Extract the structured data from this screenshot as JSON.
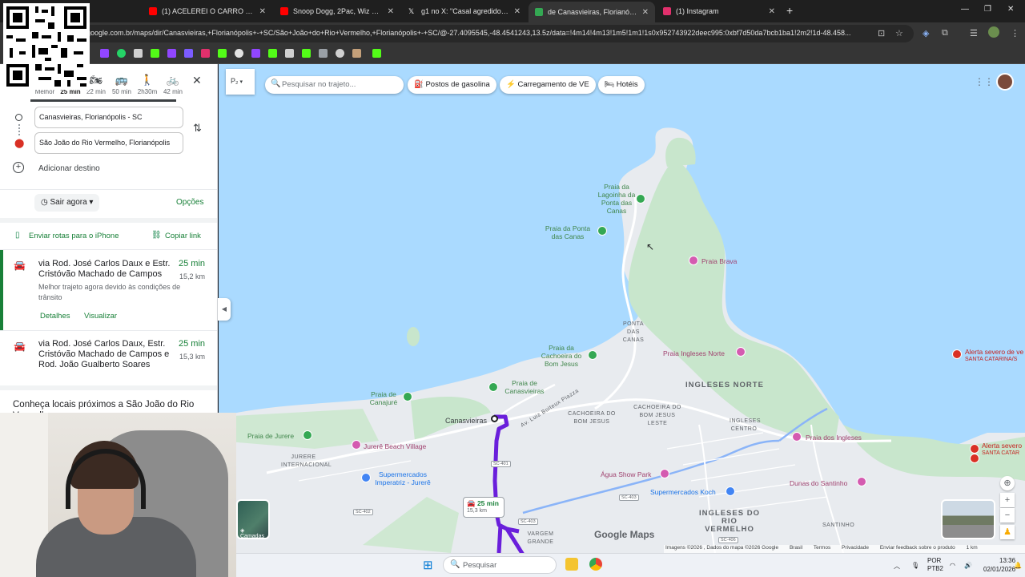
{
  "browser": {
    "tabs": [
      {
        "title": "(1) ACELEREI O CARRO MAIS IN",
        "favicon_color": "#ff0000"
      },
      {
        "title": "Snoop Dogg, 2Pac, Wiz Khalifa",
        "favicon_color": "#ff0000"
      },
      {
        "title": "g1 no X: \"Casal agredido em Po",
        "favicon_color": "#ffffff"
      },
      {
        "title": "de Canasvieiras, Florianópolis -",
        "favicon_color": "#34a853"
      },
      {
        "title": "(1) Instagram",
        "favicon_color": "#e1306c"
      }
    ],
    "url": "google.com.br/maps/dir/Canasvieiras,+Florianópolis+-+SC/São+João+do+Rio+Vermelho,+Florianópolis+-+SC/@-27.4095545,-48.4541243,13.5z/data=!4m14!4m13!1m5!1m1!1s0x952743922deec995:0xbf7d50da7bcb1ba1!2m2!1d-48.458..."
  },
  "directions": {
    "modes": [
      {
        "label": "Melhor",
        "icon": "route-icon"
      },
      {
        "label": "25 min",
        "icon": "car-icon"
      },
      {
        "label": "22 min",
        "icon": "motorcycle-icon"
      },
      {
        "label": "50 min",
        "icon": "bus-icon"
      },
      {
        "label": "2h30m",
        "icon": "walk-icon"
      },
      {
        "label": "42 min",
        "icon": "bike-icon"
      }
    ],
    "origin": "Canasvieiras, Florianópolis - SC",
    "destination": "São João do Rio Vermelho, Florianópolis",
    "add_destination": "Adicionar destino",
    "leave_now": "Sair agora",
    "options": "Opções",
    "send_to_phone": "Enviar rotas para o iPhone",
    "copy_link": "Copiar link",
    "routes": [
      {
        "title": "via Rod. José Carlos Daux e Estr. Cristóvão Machado de Campos",
        "time": "25 min",
        "distance": "15,2 km",
        "note": "Melhor trajeto agora devido às condições de trânsito",
        "details": "Detalhes",
        "view": "Visualizar"
      },
      {
        "title": "via Rod. José Carlos Daux, Estr. Cristóvão Machado de Campos e Rod. João Gualberto Soares",
        "time": "25 min",
        "distance": "15,3 km"
      }
    ],
    "nearby": "Conheça locais próximos a São João do Rio Vermelho"
  },
  "map": {
    "search_placeholder": "Pesquisar no trajeto...",
    "chips": [
      "Postos de gasolina",
      "Carregamento de VE",
      "Hotéis"
    ],
    "layer_label": "Camadas",
    "route_badge": {
      "time": "25 min",
      "distance": "15,3 km"
    },
    "logo": "Google Maps",
    "attribution": [
      "Imagens ©2026 , Dados do mapa ©2026 Google",
      "Brasil",
      "Termos",
      "Privacidade",
      "Enviar feedback sobre o produto",
      "1 km"
    ],
    "labels": {
      "lagoinha": "Praia da Lagoinha da Ponta das Canas",
      "ponta_canas_beach": "Praia da Ponta das Canas",
      "brava": "Praia Brava",
      "ponta_canas": "PONTA DAS CANAS",
      "cachoeira_beach": "Praia da Cachoeira do Bom Jesus",
      "ingleses_norte": "Praia Ingleses Norte",
      "ingleses_norte_district": "INGLESES NORTE",
      "canasvieiras_beach": "Praia de Canasvieiras",
      "cajure": "Praia de Canajuré",
      "canasvieiras": "Canasvieiras",
      "luiz_boiteux": "Av. Luiz Boiteux Piazza",
      "cachoeira_area": "CACHOEIRA DO BOM JESUS",
      "cachoeira_leste": "CACHOEIRA DO BOM JESUS LESTE",
      "ingleses_centro": "INGLESES CENTRO",
      "jurere_beach": "Praia de Jurere",
      "jurere_village": "Jurerê Beach Village",
      "jurere_int": "JURERE INTERNACIONAL",
      "imperatriz": "Supermercados Imperatriz - Jurerê",
      "agua_show": "Água Show Park",
      "koch": "Supermercados Koch",
      "ingleses_beach": "Praia dos Ingleses",
      "santinho": "Dunas do Santinho",
      "rio_vermelho": "INGLESES DO RIO VERMELHO",
      "vargem": "VARGEM GRANDE",
      "santinho_area": "SANTINHO",
      "alert1_title": "Alerta severo de ve",
      "alert1_sub": "SANTA CATARINA/S",
      "alert2_title": "Alerta severo",
      "alert2_sub": "SANTA CATAR"
    },
    "shields": [
      "SC-401",
      "SC-402",
      "SC-403",
      "SC-403",
      "SC-406"
    ]
  },
  "taskbar": {
    "search": "Pesquisar",
    "lang": "POR",
    "layout": "PTB2",
    "time": "13:36",
    "date": "02/01/2026"
  }
}
